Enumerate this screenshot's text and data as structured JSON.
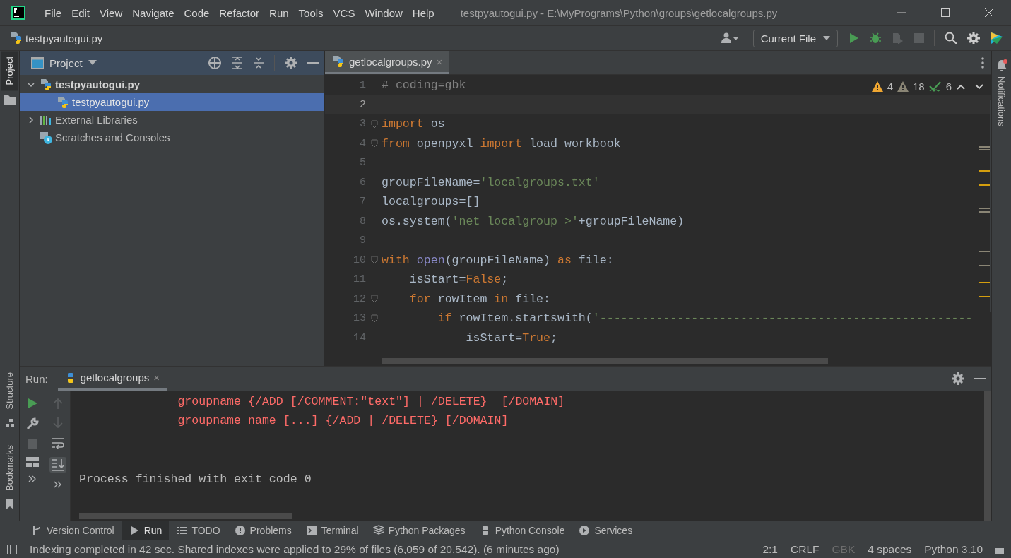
{
  "window": {
    "title": "testpyautogui.py - E:\\MyPrograms\\Python\\groups\\getlocalgroups.py",
    "menu": [
      "File",
      "Edit",
      "View",
      "Navigate",
      "Code",
      "Refactor",
      "Run",
      "Tools",
      "VCS",
      "Window",
      "Help"
    ]
  },
  "navbar": {
    "breadcrumb": "testpyautogui.py",
    "run_config": "Current File"
  },
  "left_stripe": {
    "top": [
      {
        "label": "Project",
        "selected": true
      }
    ],
    "bottom": [
      {
        "label": "Structure",
        "selected": false
      },
      {
        "label": "Bookmarks",
        "selected": false
      }
    ]
  },
  "project": {
    "title": "Project",
    "tree": [
      {
        "label": "testpyautogui.py",
        "kind": "project",
        "expanded": true,
        "selected": false,
        "children": [
          {
            "label": "testpyautogui.py",
            "kind": "file",
            "selected": true
          }
        ]
      },
      {
        "label": "External Libraries",
        "kind": "libraries",
        "expanded": false,
        "selected": false
      },
      {
        "label": "Scratches and Consoles",
        "kind": "scratches",
        "selected": false
      }
    ]
  },
  "editor": {
    "tabs": [
      {
        "label": "getlocalgroups.py",
        "close": "×"
      }
    ],
    "inspections": {
      "warnings": "4",
      "weak_warnings": "18",
      "typos": "6"
    },
    "lines": [
      {
        "number": "1",
        "current": false,
        "fold": false,
        "tokens": [
          {
            "kind": "comment",
            "text": "# coding=gbk"
          }
        ]
      },
      {
        "number": "2",
        "current": true,
        "fold": false
      },
      {
        "number": "3",
        "current": false,
        "fold": true,
        "tokens": [
          {
            "kind": "keyword",
            "text": "import"
          },
          {
            "kind": "plain",
            "text": " os"
          }
        ]
      },
      {
        "number": "4",
        "current": false,
        "fold": true,
        "tokens": [
          {
            "kind": "keyword",
            "text": "from"
          },
          {
            "kind": "plain",
            "text": " openpyxl "
          },
          {
            "kind": "keyword",
            "text": "import"
          },
          {
            "kind": "plain",
            "text": " load_workbook"
          }
        ]
      },
      {
        "number": "5",
        "current": false,
        "fold": false
      },
      {
        "number": "6",
        "current": false,
        "fold": false,
        "tokens": [
          {
            "kind": "plain",
            "text": "groupFileName="
          },
          {
            "kind": "string",
            "text": "'localgroups.txt'"
          }
        ]
      },
      {
        "number": "7",
        "current": false,
        "fold": false,
        "tokens": [
          {
            "kind": "plain",
            "text": "localgroups=[]"
          }
        ]
      },
      {
        "number": "8",
        "current": false,
        "fold": false,
        "tokens": [
          {
            "kind": "plain",
            "text": "os.system("
          },
          {
            "kind": "string",
            "text": "'net localgroup >'"
          },
          {
            "kind": "plain",
            "text": "+groupFileName)"
          }
        ]
      },
      {
        "number": "9",
        "current": false,
        "fold": false
      },
      {
        "number": "10",
        "current": false,
        "fold": true,
        "tokens": [
          {
            "kind": "keyword",
            "text": "with "
          },
          {
            "kind": "builtin",
            "text": "open"
          },
          {
            "kind": "plain",
            "text": "(groupFileName) "
          },
          {
            "kind": "keyword",
            "text": "as"
          },
          {
            "kind": "plain",
            "text": " file:"
          }
        ]
      },
      {
        "number": "11",
        "current": false,
        "fold": false,
        "tokens": [
          {
            "kind": "plain",
            "text": "    isStart="
          },
          {
            "kind": "keyword",
            "text": "False"
          },
          {
            "kind": "plain",
            "text": ";"
          }
        ]
      },
      {
        "number": "12",
        "current": false,
        "fold": true,
        "tokens": [
          {
            "kind": "keyword",
            "text": "    for"
          },
          {
            "kind": "plain",
            "text": " rowItem "
          },
          {
            "kind": "keyword",
            "text": "in"
          },
          {
            "kind": "plain",
            "text": " file:"
          }
        ]
      },
      {
        "number": "13",
        "current": false,
        "fold": true,
        "tokens": [
          {
            "kind": "keyword",
            "text": "        if"
          },
          {
            "kind": "plain",
            "text": " rowItem.startswith("
          },
          {
            "kind": "string",
            "text": "'-----------------------------------------------------"
          }
        ]
      },
      {
        "number": "14",
        "current": false,
        "fold": false,
        "tokens": [
          {
            "kind": "plain",
            "text": "            isStart="
          },
          {
            "kind": "keyword",
            "text": "True"
          },
          {
            "kind": "plain",
            "text": ";"
          }
        ]
      }
    ]
  },
  "right_stripe": {
    "label": "Notifications"
  },
  "run": {
    "label": "Run:",
    "tab": "getlocalgroups",
    "tab_close": "×",
    "lines": [
      {
        "kind": "error",
        "text": "              groupname {/ADD [/COMMENT:\"text\"] | /DELETE}  [/DOMAIN]"
      },
      {
        "kind": "error",
        "text": "              groupname name [...] {/ADD | /DELETE} [/DOMAIN]"
      },
      {
        "kind": "system",
        "text": "Process finished with exit code 0"
      }
    ]
  },
  "tool_windows": [
    {
      "label": "Version Control",
      "kind": "vcs",
      "selected": false
    },
    {
      "label": "Run",
      "kind": "run",
      "selected": true
    },
    {
      "label": "TODO",
      "kind": "todo",
      "selected": false
    },
    {
      "label": "Problems",
      "kind": "problems",
      "selected": false
    },
    {
      "label": "Terminal",
      "kind": "terminal",
      "selected": false
    },
    {
      "label": "Python Packages",
      "kind": "packages",
      "selected": false
    },
    {
      "label": "Python Console",
      "kind": "console",
      "selected": false
    },
    {
      "label": "Services",
      "kind": "services",
      "selected": false
    }
  ],
  "status_bar": {
    "message": "Indexing completed in 42 sec. Shared indexes were applied to 29% of files (6,059 of 20,542). (6 minutes ago)",
    "items": [
      {
        "text": "2:1",
        "disabled": false
      },
      {
        "text": "CRLF",
        "disabled": false
      },
      {
        "text": "GBK",
        "disabled": true
      },
      {
        "text": "4 spaces",
        "disabled": false
      },
      {
        "text": "Python 3.10",
        "disabled": false
      }
    ]
  }
}
